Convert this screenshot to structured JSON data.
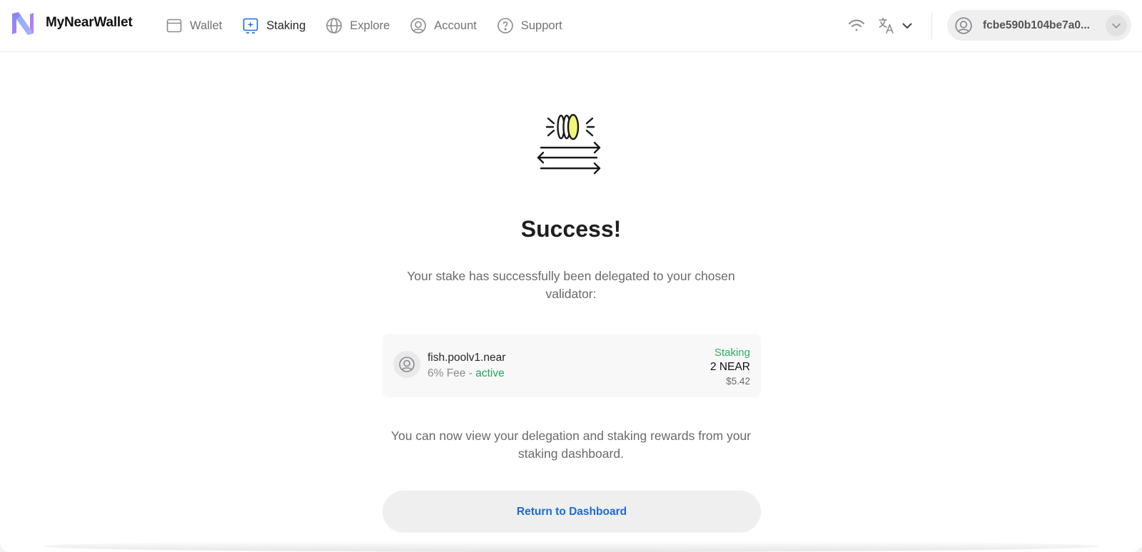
{
  "header": {
    "brand": "MyNearWallet",
    "nav": [
      {
        "label": "Wallet",
        "icon": "wallet-icon",
        "active": false
      },
      {
        "label": "Staking",
        "icon": "staking-icon",
        "active": true
      },
      {
        "label": "Explore",
        "icon": "globe-icon",
        "active": false
      },
      {
        "label": "Account",
        "icon": "user-circle-icon",
        "active": false
      },
      {
        "label": "Support",
        "icon": "question-circle-icon",
        "active": false
      }
    ],
    "account_id": "fcbe590b104be7a0..."
  },
  "main": {
    "title": "Success!",
    "description": "Your stake has successfully been delegated to your chosen validator:",
    "validator": {
      "name": "fish.poolv1.near",
      "fee_text": "6% Fee - ",
      "state": "active",
      "status": "Staking",
      "amount": "2 NEAR",
      "usd": "$5.42"
    },
    "followup": "You can now view your delegation and staking rewards from your staking dashboard.",
    "return_button": "Return to Dashboard"
  },
  "colors": {
    "accent": "#1a6bd6",
    "success_green": "#2bb065",
    "coin_yellow": "#f4f47a"
  }
}
